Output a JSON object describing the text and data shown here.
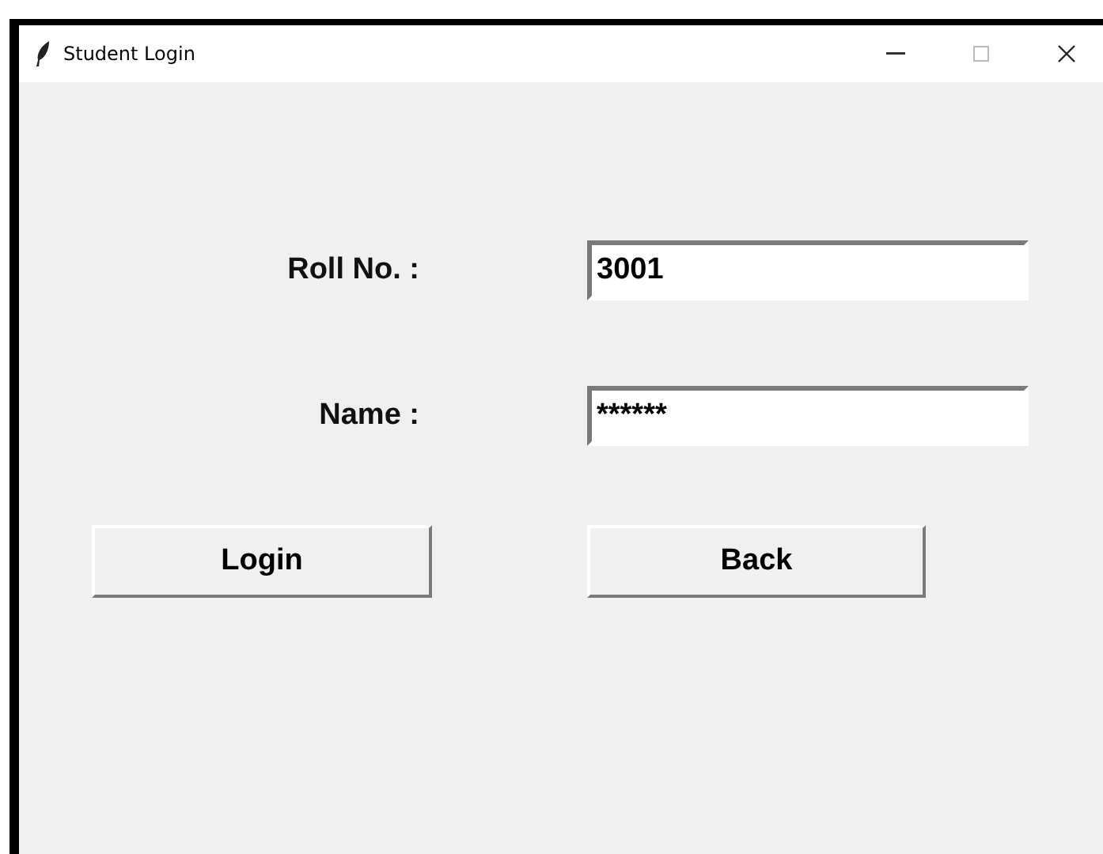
{
  "window": {
    "title": "Student Login"
  },
  "fields": [
    {
      "label": "Roll No. :",
      "value": "3001"
    },
    {
      "label": "Name :",
      "value": "******"
    }
  ],
  "buttons": [
    "Login",
    "Back"
  ]
}
